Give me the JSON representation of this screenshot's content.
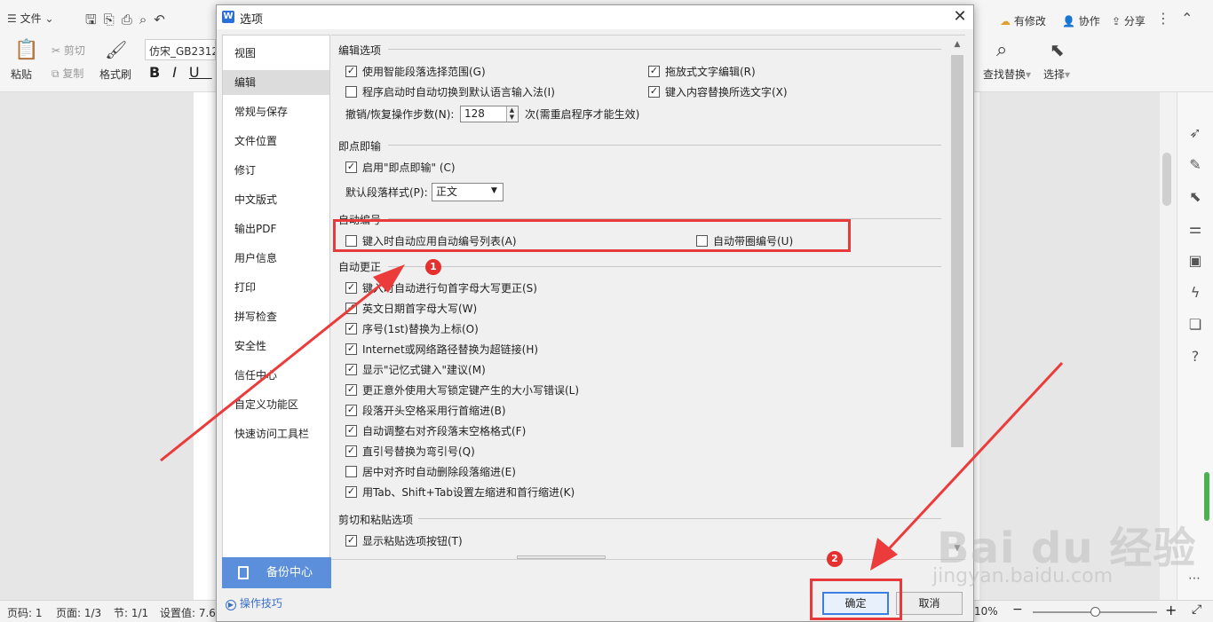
{
  "toolbar": {
    "file_label": "文件",
    "cut_label": "剪切",
    "copy_label": "复制",
    "paste_label": "粘贴",
    "format_painter_label": "格式刷",
    "font_value": "仿宋_GB2312",
    "has_changes_label": "有修改",
    "collaborate_label": "协作",
    "share_label": "分享",
    "find_replace_label": "查找替换",
    "select_label": "选择"
  },
  "statusbar": {
    "page_code": "页码: 1",
    "page_count": "页面: 1/3",
    "section": "节: 1/1",
    "setting_value": "设置值: 7.6",
    "zoom": "10%"
  },
  "dialog": {
    "title": "选项",
    "logo": "W",
    "close": "✕",
    "nav": [
      {
        "label": "视图"
      },
      {
        "label": "编辑"
      },
      {
        "label": "常规与保存"
      },
      {
        "label": "文件位置"
      },
      {
        "label": "修订"
      },
      {
        "label": "中文版式"
      },
      {
        "label": "输出PDF"
      },
      {
        "label": "用户信息"
      },
      {
        "label": "打印"
      },
      {
        "label": "拼写检查"
      },
      {
        "label": "安全性"
      },
      {
        "label": "信任中心"
      },
      {
        "label": "自定义功能区"
      },
      {
        "label": "快速访问工具栏"
      }
    ],
    "selected_nav": "编辑",
    "backup_label": "备份中心",
    "tips_label": "操作技巧",
    "ok_label": "确定",
    "cancel_label": "取消",
    "sections": {
      "edit_options": "编辑选项",
      "click_type": "即点即输",
      "auto_number": "自动编号",
      "auto_correct": "自动更正",
      "cut_paste": "剪切和粘贴选项"
    },
    "edit_options": {
      "smart_para_select": "使用智能段落选择范围(G)",
      "drag_drop": "拖放式文字编辑(R)",
      "auto_switch_lang": "程序启动时自动切换到默认语言输入法(I)",
      "type_replace": "键入内容替换所选文字(X)",
      "undo_steps_label": "撤销/恢复操作步数(N):",
      "undo_steps_value": "128",
      "undo_steps_note": "次(需重启程序才能生效)"
    },
    "click_type": {
      "enable": "启用\"即点即输\" (C)",
      "default_style_label": "默认段落样式(P):",
      "default_style_value": "正文"
    },
    "auto_number": {
      "apply_list": "键入时自动应用自动编号列表(A)",
      "circle_number": "自动带圈编号(U)"
    },
    "auto_correct": [
      {
        "label": "键入时自动进行句首字母大写更正(S)",
        "checked": true
      },
      {
        "label": "英文日期首字母大写(W)",
        "checked": true
      },
      {
        "label": "序号(1st)替换为上标(O)",
        "checked": true
      },
      {
        "label": "Internet或网络路径替换为超链接(H)",
        "checked": true
      },
      {
        "label": "显示\"记忆式键入\"建议(M)",
        "checked": true
      },
      {
        "label": "更正意外使用大写锁定键产生的大小写错误(L)",
        "checked": true
      },
      {
        "label": "段落开头空格采用行首缩进(B)",
        "checked": true
      },
      {
        "label": "自动调整右对齐段落末空格格式(F)",
        "checked": true
      },
      {
        "label": "直引号替换为弯引号(Q)",
        "checked": true
      },
      {
        "label": "居中对齐时自动删除段落缩进(E)",
        "checked": false
      },
      {
        "label": "用Tab、Shift+Tab设置左缩进和首行缩进(K)",
        "checked": true
      }
    ],
    "cut_paste": {
      "show_paste_btn": "显示粘贴选项按钮(T)"
    }
  },
  "annotations": {
    "badge1": "1",
    "badge2": "2",
    "color": "#e83a3a"
  },
  "watermark": {
    "main": "Bai du 经验",
    "sub": "jingyan.baidu.com"
  }
}
